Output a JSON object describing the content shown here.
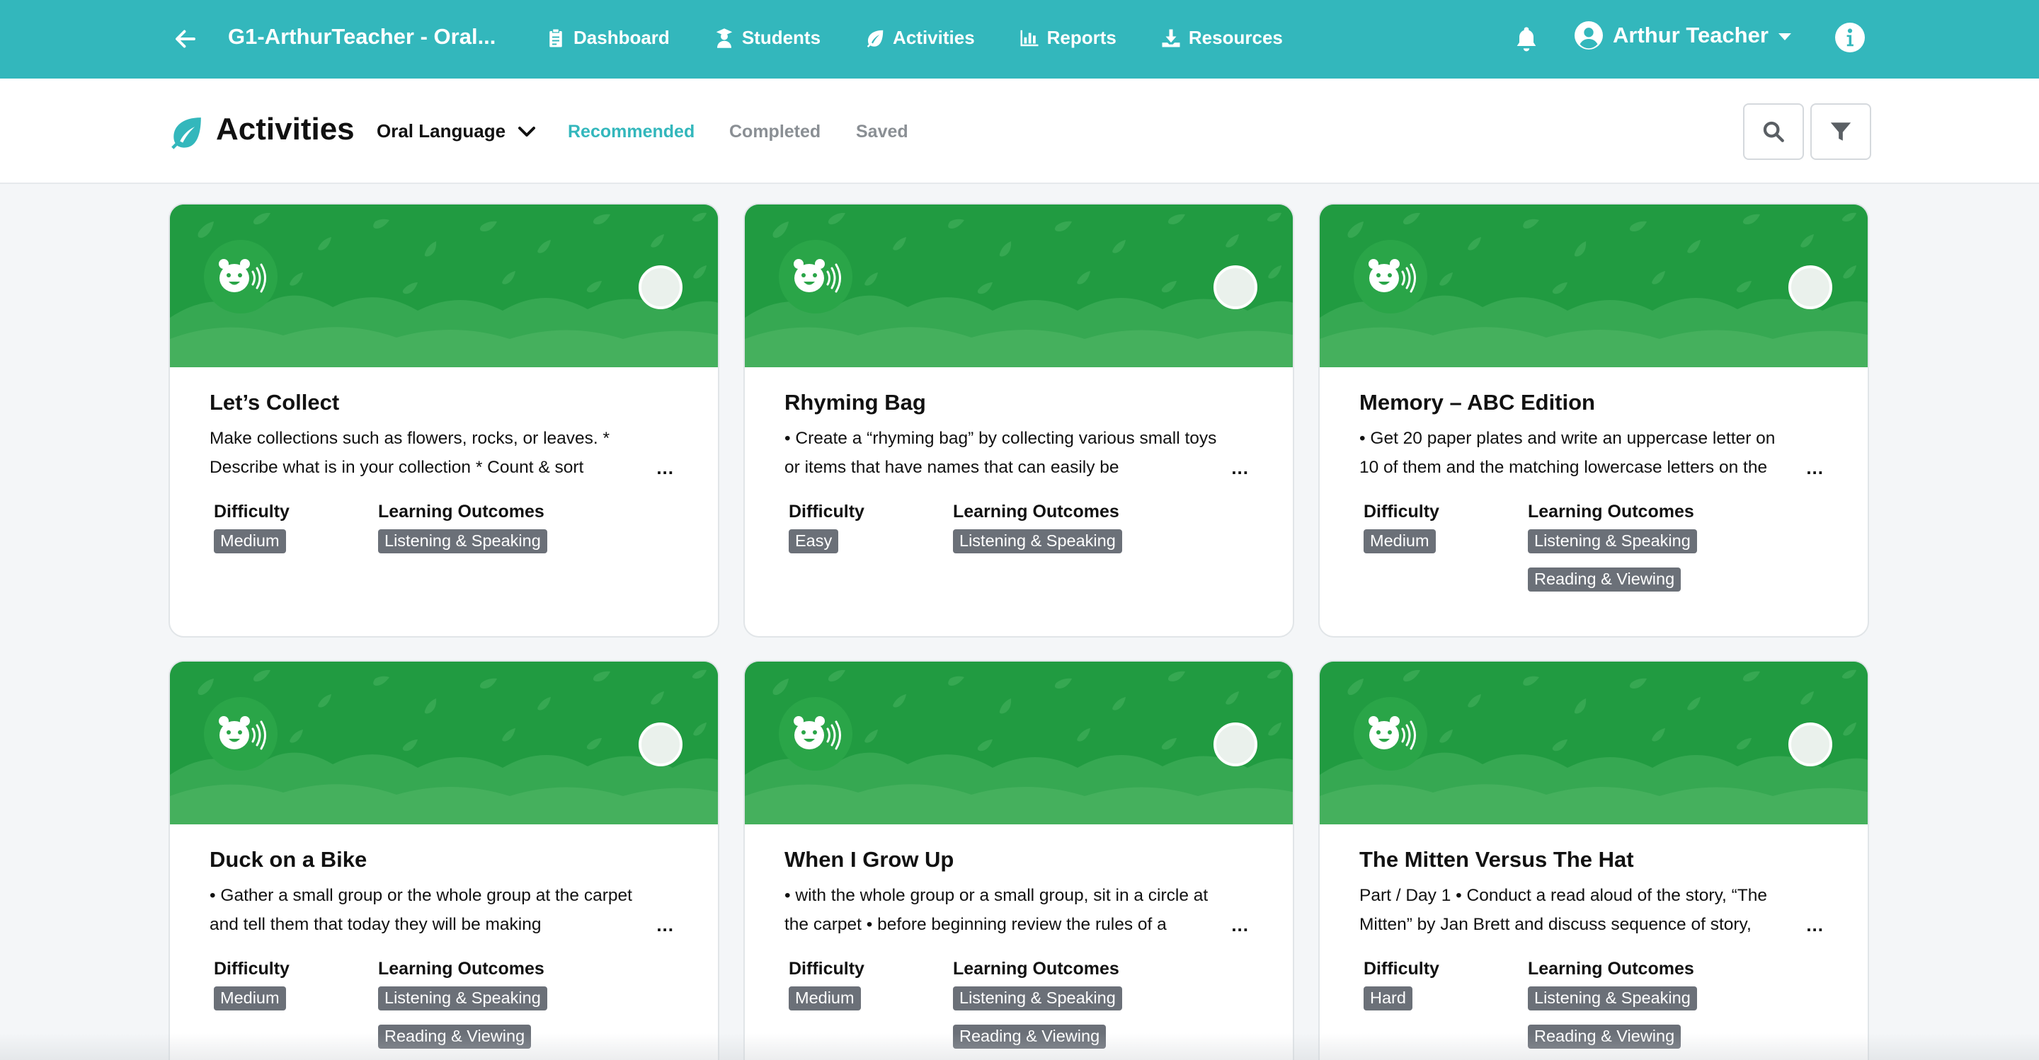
{
  "topbar": {
    "back_icon": "arrow-left-icon",
    "app_title": "G1-ArthurTeacher - Oral...",
    "nav": [
      {
        "label": "Dashboard",
        "icon": "clipboard-icon"
      },
      {
        "label": "Students",
        "icon": "students-icon"
      },
      {
        "label": "Activities",
        "icon": "leaf-icon"
      },
      {
        "label": "Reports",
        "icon": "bar-chart-icon"
      },
      {
        "label": "Resources",
        "icon": "download-icon"
      }
    ],
    "user_name": "Arthur Teacher",
    "bell_icon": "bell-icon",
    "info_icon": "info-icon",
    "color": "#33b7bc"
  },
  "subheader": {
    "title": "Activities",
    "subject_select": "Oral Language",
    "tabs": [
      {
        "label": "Recommended",
        "active": true
      },
      {
        "label": "Completed",
        "active": false
      },
      {
        "label": "Saved",
        "active": false
      }
    ],
    "search_icon": "search-icon",
    "filter_icon": "filter-icon"
  },
  "labels": {
    "difficulty": "Difficulty",
    "outcomes": "Learning Outcomes",
    "more": "..."
  },
  "cards": [
    {
      "title": "Let’s Collect",
      "description": "Make collections such as flowers, rocks, or leaves. * Describe what is in your collection * Count & sort",
      "difficulty": "Medium",
      "outcomes": [
        "Listening & Speaking"
      ]
    },
    {
      "title": "Rhyming Bag",
      "description": "• Create a “rhyming bag” by collecting various small toys or items that have names that can easily be",
      "difficulty": "Easy",
      "outcomes": [
        "Listening & Speaking"
      ]
    },
    {
      "title": "Memory – ABC Edition",
      "description": "• Get 20 paper plates and write an uppercase letter on 10 of them and the matching lowercase letters on the",
      "difficulty": "Medium",
      "outcomes": [
        "Listening & Speaking",
        "Reading & Viewing"
      ]
    },
    {
      "title": "Duck on a Bike",
      "description": "• Gather a small group or the whole group at the carpet and tell them that today they will be making",
      "difficulty": "Medium",
      "outcomes": [
        "Listening & Speaking",
        "Reading & Viewing"
      ]
    },
    {
      "title": "When I Grow Up",
      "description": "• with the whole group or a small group, sit in a circle at the carpet • before beginning review the rules of a",
      "difficulty": "Medium",
      "outcomes": [
        "Listening & Speaking",
        "Reading & Viewing"
      ]
    },
    {
      "title": "The Mitten Versus The Hat",
      "description": "Part / Day 1 • Conduct a read aloud of the story, “The Mitten” by Jan Brett and discuss sequence of story,",
      "difficulty": "Hard",
      "outcomes": [
        "Listening & Speaking",
        "Reading & Viewing"
      ]
    }
  ]
}
